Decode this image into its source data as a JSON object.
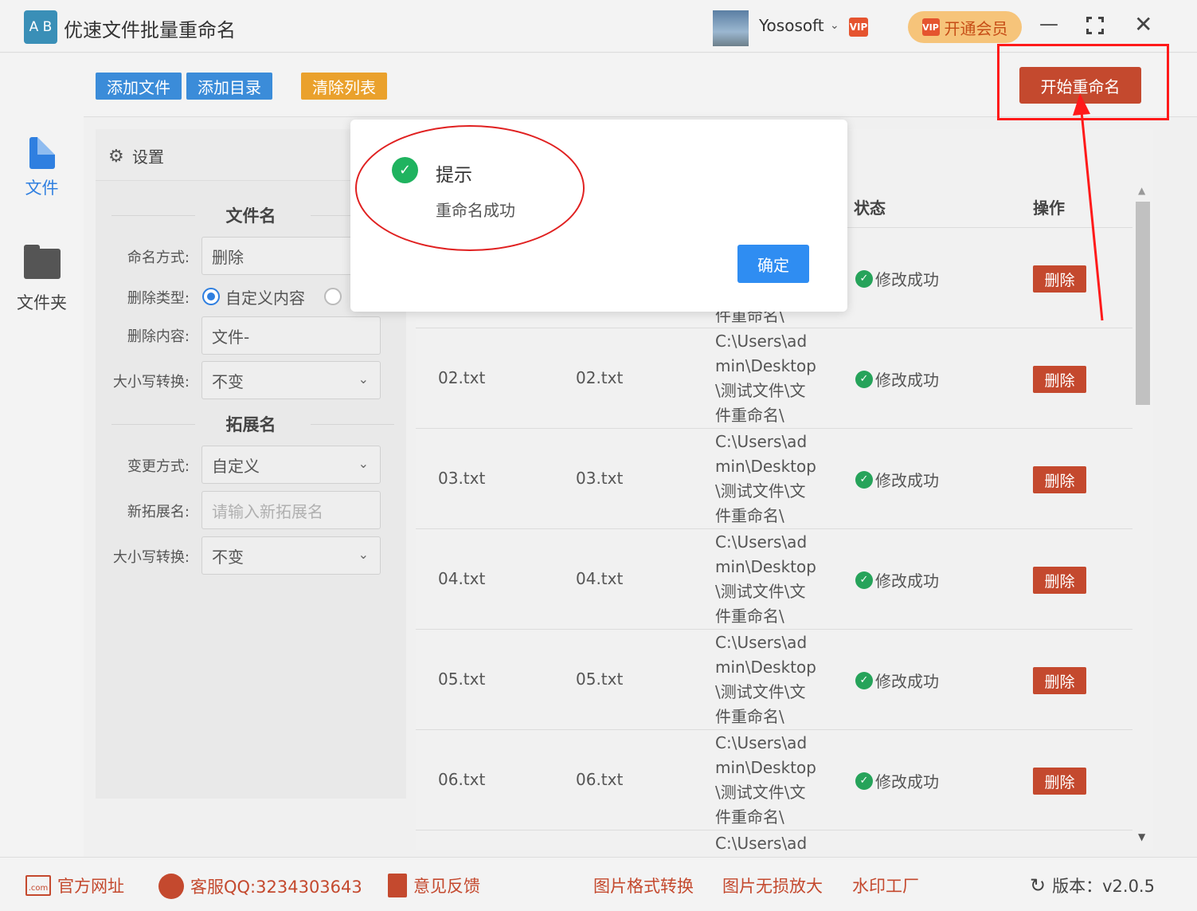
{
  "titlebar": {
    "app_logo": "A B",
    "app_title": "优速文件批量重命名",
    "user_name": "Yososoft",
    "vip_badge": "VIP",
    "vip_button": "开通会员"
  },
  "leftnav": {
    "items": [
      {
        "label": "文件",
        "icon": "file-icon",
        "active": true
      },
      {
        "label": "文件夹",
        "icon": "folder-icon",
        "active": false
      }
    ]
  },
  "toolbar": {
    "add_file": "添加文件",
    "add_dir": "添加目录",
    "clear_list": "清除列表",
    "start_rename": "开始重命名"
  },
  "settings": {
    "title": "设置",
    "filename_section": "文件名",
    "naming_method_label": "命名方式:",
    "naming_method_value": "删除",
    "delete_type_label": "删除类型:",
    "delete_type_option1": "自定义内容",
    "delete_content_label": "删除内容:",
    "delete_content_value": "文件-",
    "case_label": "大小写转换:",
    "case_value": "不变",
    "ext_section": "拓展名",
    "change_method_label": "变更方式:",
    "change_method_value": "自定义",
    "new_ext_label": "新拓展名:",
    "new_ext_placeholder": "请输入新拓展名",
    "ext_case_label": "大小写转换:",
    "ext_case_value": "不变"
  },
  "table": {
    "headers": {
      "status": "状态",
      "action": "操作"
    },
    "first_row_path_tail": "件重命名\\",
    "rows": [
      {
        "original": "",
        "new": "",
        "path": "",
        "status": "修改成功",
        "action": "删除"
      },
      {
        "original": "02.txt",
        "new": "02.txt",
        "path_lines": [
          "C:\\Users\\ad",
          "min\\Desktop",
          "\\测试文件\\文",
          "件重命名\\"
        ],
        "status": "修改成功",
        "action": "删除"
      },
      {
        "original": "03.txt",
        "new": "03.txt",
        "path_lines": [
          "C:\\Users\\ad",
          "min\\Desktop",
          "\\测试文件\\文",
          "件重命名\\"
        ],
        "status": "修改成功",
        "action": "删除"
      },
      {
        "original": "04.txt",
        "new": "04.txt",
        "path_lines": [
          "C:\\Users\\ad",
          "min\\Desktop",
          "\\测试文件\\文",
          "件重命名\\"
        ],
        "status": "修改成功",
        "action": "删除"
      },
      {
        "original": "05.txt",
        "new": "05.txt",
        "path_lines": [
          "C:\\Users\\ad",
          "min\\Desktop",
          "\\测试文件\\文",
          "件重命名\\"
        ],
        "status": "修改成功",
        "action": "删除"
      },
      {
        "original": "06.txt",
        "new": "06.txt",
        "path_lines": [
          "C:\\Users\\ad",
          "min\\Desktop",
          "\\测试文件\\文",
          "件重命名\\"
        ],
        "status": "修改成功",
        "action": "删除"
      }
    ],
    "partial_row_path": "C:\\Users\\ad"
  },
  "footer": {
    "website": "官方网址",
    "website_icon_text": ".com",
    "qq": "客服QQ:3234303643",
    "feedback": "意见反馈",
    "img_convert": "图片格式转换",
    "img_enlarge": "图片无损放大",
    "watermark": "水印工厂",
    "version": "版本：v2.0.5"
  },
  "modal": {
    "title": "提示",
    "message": "重命名成功",
    "ok": "确定"
  },
  "colors": {
    "primary_blue": "#3b8cd9",
    "orange": "#eaa12c",
    "danger_red": "#c4492e",
    "success_green": "#26a35a",
    "annotation_red": "#ff1a1a"
  }
}
